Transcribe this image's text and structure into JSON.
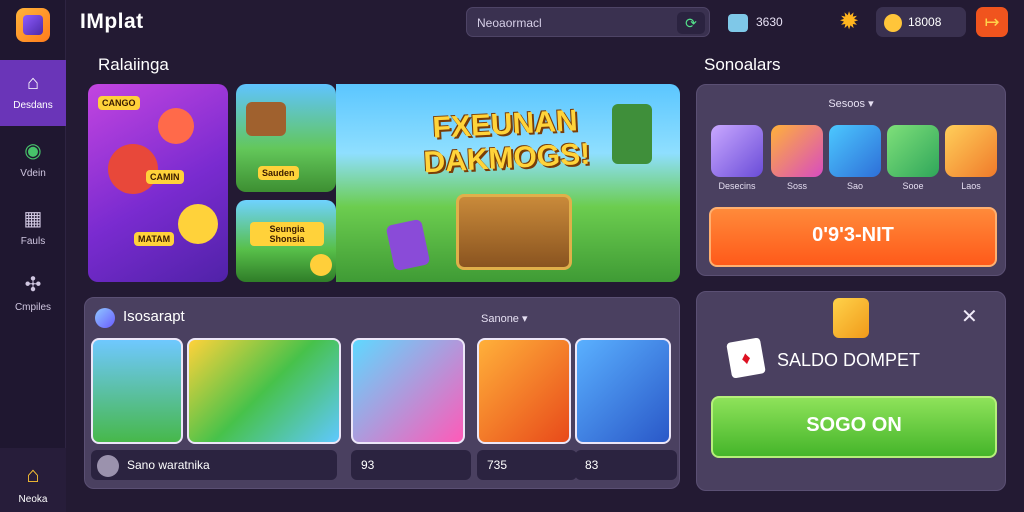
{
  "app": {
    "title": "IMplat"
  },
  "colors": {
    "accent": "#6a35b8",
    "orange_button": "#ff6a24",
    "green_button": "#5cc63a",
    "panel": "#4a4060",
    "background": "#231a33"
  },
  "sidebar": {
    "items": [
      {
        "label": "Desdans",
        "icon": "home-icon"
      },
      {
        "label": "Vdein",
        "icon": "globe-icon"
      },
      {
        "label": "Fauls",
        "icon": "store-icon"
      },
      {
        "label": "Cmpiles",
        "icon": "gamepad-icon"
      }
    ],
    "bottom": {
      "label": "Neoka",
      "icon": "house-icon"
    }
  },
  "topbar": {
    "search": {
      "text": "Neoaormacl"
    },
    "counter": "3630",
    "coins": "18008"
  },
  "featured": {
    "heading": "Ralaiinga",
    "hero_title": "FXEUNAN DAKMOGS!",
    "card1_tags": [
      "CANGO",
      "CAMIN",
      "MATAM"
    ],
    "card2_tag": "Sauden",
    "card3_tag": "Seungia Shonsia"
  },
  "right_top": {
    "heading": "Sonoalars",
    "dropdown": "Sesoos",
    "games": [
      "Desecins",
      "Soss",
      "Sao",
      "Sooe",
      "Laos"
    ],
    "button": "0'9'3-NIT"
  },
  "recommended": {
    "title": "Isosarapt",
    "dropdown": "Sanone",
    "chips": [
      "Sano waratnika",
      "93",
      "735",
      "83"
    ]
  },
  "right_bottom": {
    "label": "SALDO DOMPET",
    "button": "SOGO ON"
  }
}
